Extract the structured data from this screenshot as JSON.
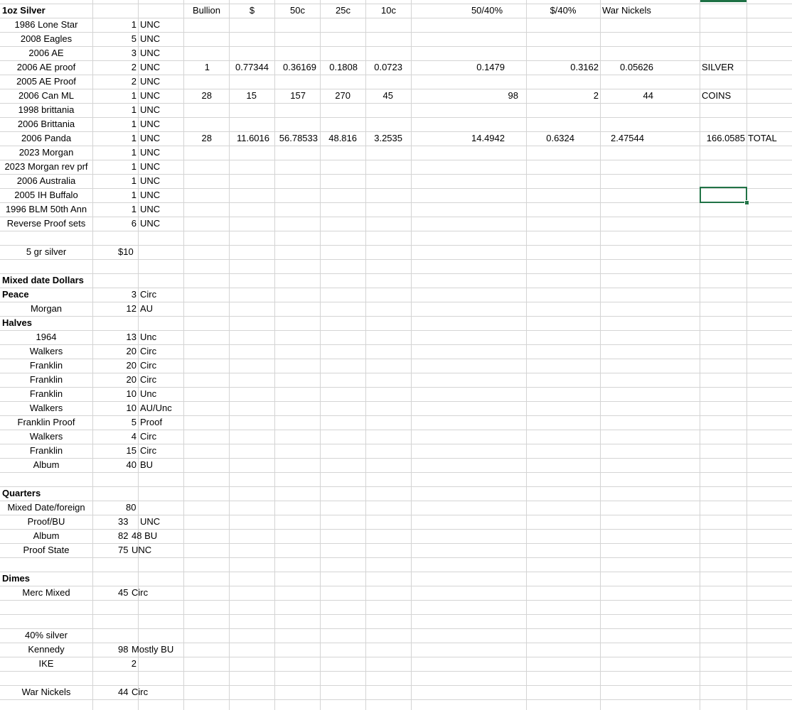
{
  "header": {
    "bullion": "Bullion",
    "dollar": "$",
    "c50": "50c",
    "c25": "25c",
    "c10": "10c",
    "c50_40": "50/40%",
    "d_40": "$/40%",
    "war_nickels": "War Nickels"
  },
  "one_oz": {
    "title": "1oz Silver",
    "items": [
      {
        "name": "1986 Lone Star",
        "qty": "1",
        "grade": "UNC"
      },
      {
        "name": "2008 Eagles",
        "qty": "5",
        "grade": "UNC"
      },
      {
        "name": "2006 AE",
        "qty": "3",
        "grade": "UNC"
      },
      {
        "name": "2006 AE proof",
        "qty": "2",
        "grade": "UNC"
      },
      {
        "name": "2005 AE Proof",
        "qty": "2",
        "grade": "UNC"
      },
      {
        "name": "2006 Can ML",
        "qty": "1",
        "grade": "UNC"
      },
      {
        "name": "1998 brittania",
        "qty": "1",
        "grade": "UNC"
      },
      {
        "name": "2006 Brittania",
        "qty": "1",
        "grade": "UNC"
      },
      {
        "name": "2006 Panda",
        "qty": "1",
        "grade": "UNC"
      },
      {
        "name": "2023 Morgan",
        "qty": "1",
        "grade": "UNC"
      },
      {
        "name": "2023 Morgan rev prf",
        "qty": "1",
        "grade": "UNC"
      },
      {
        "name": "2006 Australia",
        "qty": "1",
        "grade": "UNC"
      },
      {
        "name": "2005 IH Buffalo",
        "qty": "1",
        "grade": "UNC"
      },
      {
        "name": "1996 BLM 50th Ann",
        "qty": "1",
        "grade": "UNC"
      },
      {
        "name": "Reverse Proof sets",
        "qty": "6",
        "grade": "UNC"
      }
    ]
  },
  "calc": {
    "row1": {
      "bullion": "1",
      "dollar": "0.77344",
      "c50": "0.36169",
      "c25": "0.1808",
      "c10": "0.0723",
      "c50_40": "0.1479",
      "d_40": "0.3162",
      "war": "0.05626",
      "label": "SILVER"
    },
    "row2": {
      "bullion": "28",
      "dollar": "15",
      "c50": "157",
      "c25": "270",
      "c10": "45",
      "c50_40": "98",
      "d_40": "2",
      "war": "44",
      "label": "COINS"
    },
    "row3": {
      "bullion": "28",
      "dollar": "11.6016",
      "c50": "56.78533",
      "c25": "48.816",
      "c10": "3.2535",
      "c50_40": "14.4942",
      "d_40": "0.6324",
      "war": "2.47544",
      "total": "166.0585",
      "label": "TOTAL"
    }
  },
  "five_gr": {
    "name": "5 gr silver",
    "value": "$10"
  },
  "mixed_dollars": {
    "title": "Mixed date Dollars",
    "peace": {
      "name": "Peace",
      "qty": "3",
      "grade": "Circ"
    },
    "morgan": {
      "name": "Morgan",
      "qty": "12",
      "grade": "AU"
    }
  },
  "halves": {
    "title": "Halves",
    "items": [
      {
        "name": "1964",
        "qty": "13",
        "grade": "Unc"
      },
      {
        "name": "Walkers",
        "qty": "20",
        "grade": "Circ"
      },
      {
        "name": "Franklin",
        "qty": "20",
        "grade": "Circ"
      },
      {
        "name": "Franklin",
        "qty": "20",
        "grade": "Circ"
      },
      {
        "name": "Franklin",
        "qty": "10",
        "grade": "Unc"
      },
      {
        "name": "Walkers",
        "qty": "10",
        "grade": "AU/Unc"
      },
      {
        "name": "Franklin Proof",
        "qty": "5",
        "grade": "Proof"
      },
      {
        "name": "Walkers",
        "qty": "4",
        "grade": "Circ"
      },
      {
        "name": "Franklin",
        "qty": "15",
        "grade": "Circ"
      },
      {
        "name": "Album",
        "qty": "40",
        "grade": "BU"
      }
    ]
  },
  "quarters": {
    "title": "Quarters",
    "items": [
      {
        "name": "Mixed Date/foreign",
        "qty": "80",
        "grade": ""
      },
      {
        "name": "Proof/BU",
        "qty": "33",
        "grade": "UNC"
      },
      {
        "name": "Album",
        "qty": "82",
        "grade": "48 BU"
      },
      {
        "name": "Proof State",
        "qty": "75",
        "grade": "UNC"
      }
    ]
  },
  "dimes": {
    "title": "Dimes",
    "items": [
      {
        "name": "Merc Mixed",
        "qty": "45",
        "grade": "Circ"
      }
    ]
  },
  "forty": {
    "title": "40% silver",
    "items": [
      {
        "name": "Kennedy",
        "qty": "98",
        "grade": "Mostly BU"
      },
      {
        "name": "IKE",
        "qty": "2",
        "grade": ""
      }
    ]
  },
  "war_nickels": {
    "name": "War Nickels",
    "qty": "44",
    "grade": "Circ"
  },
  "colors": {
    "grid": "#d4d4d4",
    "selection": "#217346"
  }
}
